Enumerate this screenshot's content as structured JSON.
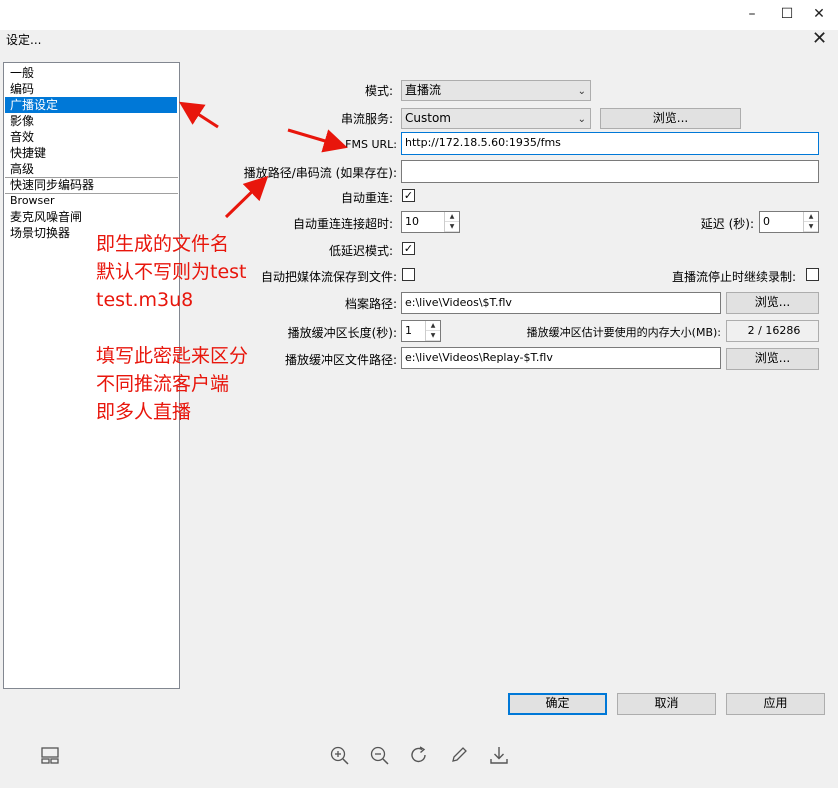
{
  "window": {
    "minimize_icon": "–",
    "maximize_icon": "☐",
    "close_icon": "✕",
    "dialog_title": "设定...",
    "dialog_close": "✕"
  },
  "sidebar": {
    "items": [
      "一般",
      "编码",
      "广播设定",
      "影像",
      "音效",
      "快捷键",
      "高级",
      "快速同步编码器",
      "Browser",
      "麦克风噪音闸",
      "场景切换器"
    ]
  },
  "form": {
    "mode_label": "模式:",
    "mode_value": "直播流",
    "service_label": "串流服务:",
    "service_value": "Custom",
    "browse1": "浏览...",
    "fms_label": "FMS URL:",
    "fms_value": "http://172.18.5.60:1935/fms",
    "playpath_label": "播放路径/串码流 (如果存在):",
    "playpath_value": "",
    "autoreconnect_label": "自动重连:",
    "timeout_label": "自动重连连接超时:",
    "timeout_value": "10",
    "delay_label": "延迟 (秒):",
    "delay_value": "0",
    "lowlatency_label": "低延迟模式:",
    "savefile_label": "自动把媒体流保存到文件:",
    "keeprecord_label": "直播流停止时继续录制:",
    "filepath_label": "档案路径:",
    "filepath_value": "e:\\live\\Videos\\$T.flv",
    "browse2": "浏览...",
    "buffer_len_label": "播放缓冲区长度(秒):",
    "buffer_len_value": "1",
    "buffer_mem_label": "播放缓冲区估计要使用的内存大小(MB):",
    "buffer_mem_value": "2 / 16286",
    "buffer_path_label": "播放缓冲区文件路径:",
    "buffer_path_value": "e:\\live\\Videos\\Replay-$T.flv",
    "browse3": "浏览..."
  },
  "buttons": {
    "ok": "确定",
    "cancel": "取消",
    "apply": "应用"
  },
  "annotations": {
    "line1": "即生成的文件名",
    "line2": "默认不写则为test",
    "line3": "test.m3u8",
    "line4": "填写此密匙来区分",
    "line5": "不同推流客户端",
    "line6": "即多人直播"
  },
  "colors": {
    "accent": "#0078d7",
    "annotation": "#e8160c"
  }
}
